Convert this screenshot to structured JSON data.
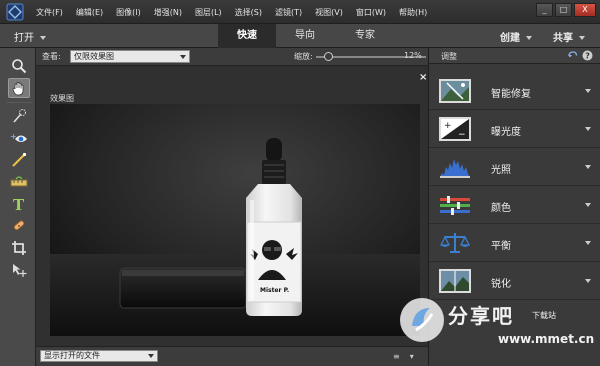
{
  "menu": {
    "items": [
      "文件(F)",
      "编辑(E)",
      "图像(I)",
      "增强(N)",
      "图层(L)",
      "选择(S)",
      "滤镜(T)",
      "视图(V)",
      "窗口(W)",
      "帮助(H)"
    ],
    "window_buttons": [
      "_",
      "□",
      "X"
    ]
  },
  "modebar": {
    "open_label": "打开",
    "tabs": [
      "快速",
      "导向",
      "专家"
    ],
    "active_tab": "快速",
    "create_label": "创建",
    "share_label": "共享"
  },
  "toolbox": {
    "tools": [
      "zoom-icon",
      "hand-icon",
      "quick-selection-icon",
      "eye-icon",
      "whiten-teeth-icon",
      "straighten-icon",
      "type-icon",
      "spot-healing-icon",
      "crop-icon",
      "move-icon"
    ],
    "selected": "hand-icon"
  },
  "options": {
    "view_label": "查看:",
    "view_value": "仅限效果图",
    "zoom_label": "缩放:",
    "zoom_value": "12%",
    "zoom_fraction": 0.12
  },
  "document": {
    "title": "效果图",
    "close": "×",
    "bottle_label": "Mister P."
  },
  "bottombar": {
    "files_value": "显示打开的文件"
  },
  "panel": {
    "title": "调整",
    "items": [
      {
        "label": "智能修复",
        "icon": "smart-fix-icon"
      },
      {
        "label": "曝光度",
        "icon": "exposure-icon"
      },
      {
        "label": "光照",
        "icon": "lighting-icon"
      },
      {
        "label": "颜色",
        "icon": "color-icon"
      },
      {
        "label": "平衡",
        "icon": "balance-icon"
      },
      {
        "label": "锐化",
        "icon": "sharpen-icon"
      }
    ]
  },
  "watermark": {
    "brand": "分享吧",
    "sub": "下载站",
    "url": "www.mmet.cn"
  },
  "colors": {
    "accent_exposure": "#ffffff",
    "window_close": "#c0392b"
  }
}
